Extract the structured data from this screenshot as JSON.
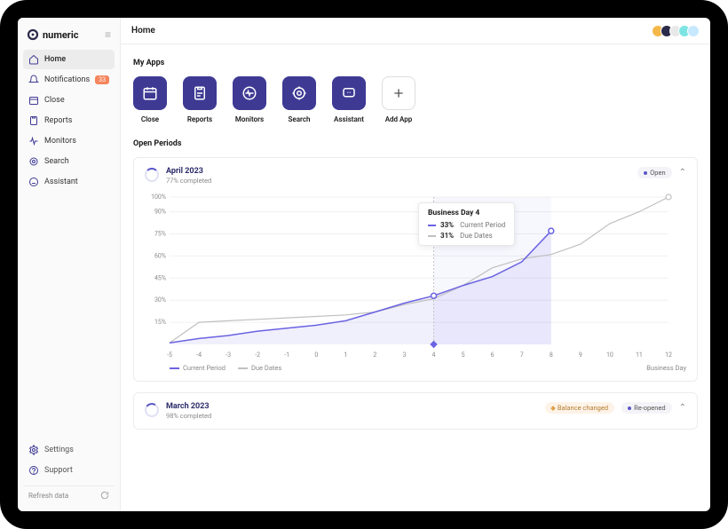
{
  "brand": {
    "name": "numeric"
  },
  "page_title": "Home",
  "sidebar": {
    "items": [
      {
        "label": "Home",
        "icon": "home-icon",
        "active": true
      },
      {
        "label": "Notifications",
        "icon": "bell-icon",
        "badge": "33"
      },
      {
        "label": "Close",
        "icon": "calendar-icon"
      },
      {
        "label": "Reports",
        "icon": "clipboard-icon"
      },
      {
        "label": "Monitors",
        "icon": "pulse-icon"
      },
      {
        "label": "Search",
        "icon": "target-icon"
      },
      {
        "label": "Assistant",
        "icon": "chat-icon"
      }
    ],
    "bottom": [
      {
        "label": "Settings",
        "icon": "cog-icon"
      },
      {
        "label": "Support",
        "icon": "help-icon"
      }
    ],
    "refresh_label": "Refresh data"
  },
  "my_apps": {
    "title": "My Apps",
    "items": [
      {
        "label": "Close",
        "icon": "calendar-icon"
      },
      {
        "label": "Reports",
        "icon": "clipboard-icon"
      },
      {
        "label": "Monitors",
        "icon": "pulse-icon"
      },
      {
        "label": "Search",
        "icon": "target-icon"
      },
      {
        "label": "Assistant",
        "icon": "chat-icon"
      },
      {
        "label": "Add App",
        "icon": "plus-icon",
        "light": true
      }
    ]
  },
  "open_periods": {
    "title": "Open Periods",
    "periods": [
      {
        "name": "April 2023",
        "subtitle": "77% completed",
        "status": "Open",
        "expanded": true,
        "tooltip": {
          "title": "Business Day 4",
          "rows": [
            {
              "value": "33%",
              "label": "Current Period",
              "series": "current"
            },
            {
              "value": "31%",
              "label": "Due Dates",
              "series": "due"
            }
          ]
        }
      },
      {
        "name": "March 2023",
        "subtitle": "98% completed",
        "badges": [
          "Balance changed",
          "Re-opened"
        ],
        "expanded": false
      }
    ]
  },
  "legend": {
    "current": "Current Period",
    "due": "Due Dates",
    "xlabel": "Business Day"
  },
  "chart_data": {
    "type": "line",
    "title": "April 2023 — completion by business day",
    "xlabel": "Business Day",
    "ylabel": "%",
    "ylim": [
      0,
      100
    ],
    "hover_x": 4,
    "current_end_x": 8,
    "x": [
      -5,
      -4,
      -3,
      -2,
      -1,
      0,
      1,
      2,
      3,
      4,
      5,
      6,
      7,
      8,
      9,
      10,
      11,
      12
    ],
    "y_ticks": [
      15,
      30,
      45,
      60,
      75,
      90,
      100
    ],
    "series": [
      {
        "name": "Current Period",
        "values": [
          1,
          4,
          6,
          9,
          11,
          13,
          16,
          22,
          28,
          33,
          40,
          46,
          56,
          77,
          null,
          null,
          null,
          null
        ]
      },
      {
        "name": "Due Dates",
        "values": [
          1,
          15,
          16,
          17,
          18,
          19,
          20,
          22,
          27,
          31,
          40,
          52,
          58,
          61,
          68,
          82,
          90,
          100
        ]
      }
    ]
  }
}
